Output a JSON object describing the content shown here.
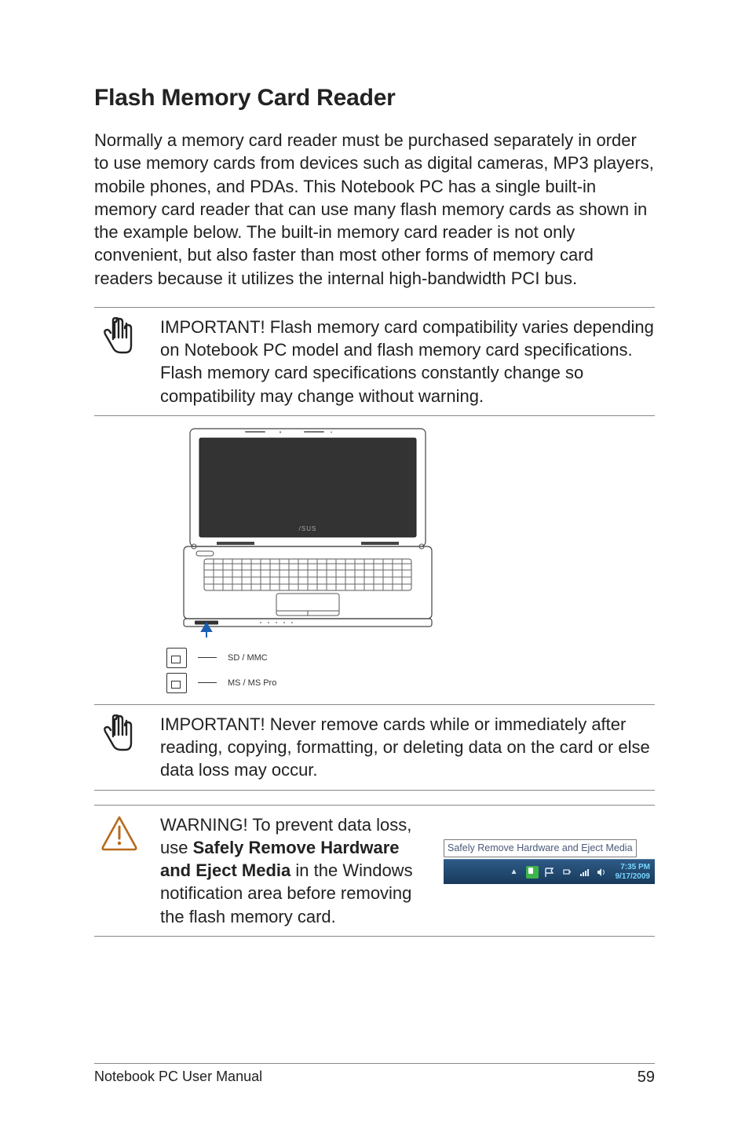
{
  "heading": "Flash Memory Card Reader",
  "body_para": "Normally a memory card reader must be purchased separately in order to use memory cards from devices such as digital cameras, MP3 players, mobile phones, and PDAs. This Notebook PC has a single built-in memory card reader that can use many flash memory cards as shown in the example below. The built-in memory card reader is not only convenient, but also faster than most other forms of memory card readers because it utilizes the internal high-bandwidth PCI bus.",
  "important1": "IMPORTANT! Flash memory card compatibility varies depending on Notebook PC model and flash memory card specifications. Flash memory card specifications constantly change so compatibility may change without warning.",
  "card_labels": {
    "sd": "SD / MMC",
    "ms": "MS / MS Pro"
  },
  "important2": "IMPORTANT!  Never remove cards while or immediately after reading, copying, formatting, or deleting data on the card or else data loss may occur.",
  "warning": {
    "prefix": "WARNING! To prevent data loss, use ",
    "bold1": "Safely Remove Hardware and Eject Media",
    "rest": " in the Windows notification area before removing the flash memory card."
  },
  "tooltip": "Safely Remove Hardware and Eject Media",
  "clock": {
    "time": "7:35 PM",
    "date": "9/17/2009"
  },
  "footer": {
    "left": "Notebook PC User Manual",
    "right": "59"
  }
}
